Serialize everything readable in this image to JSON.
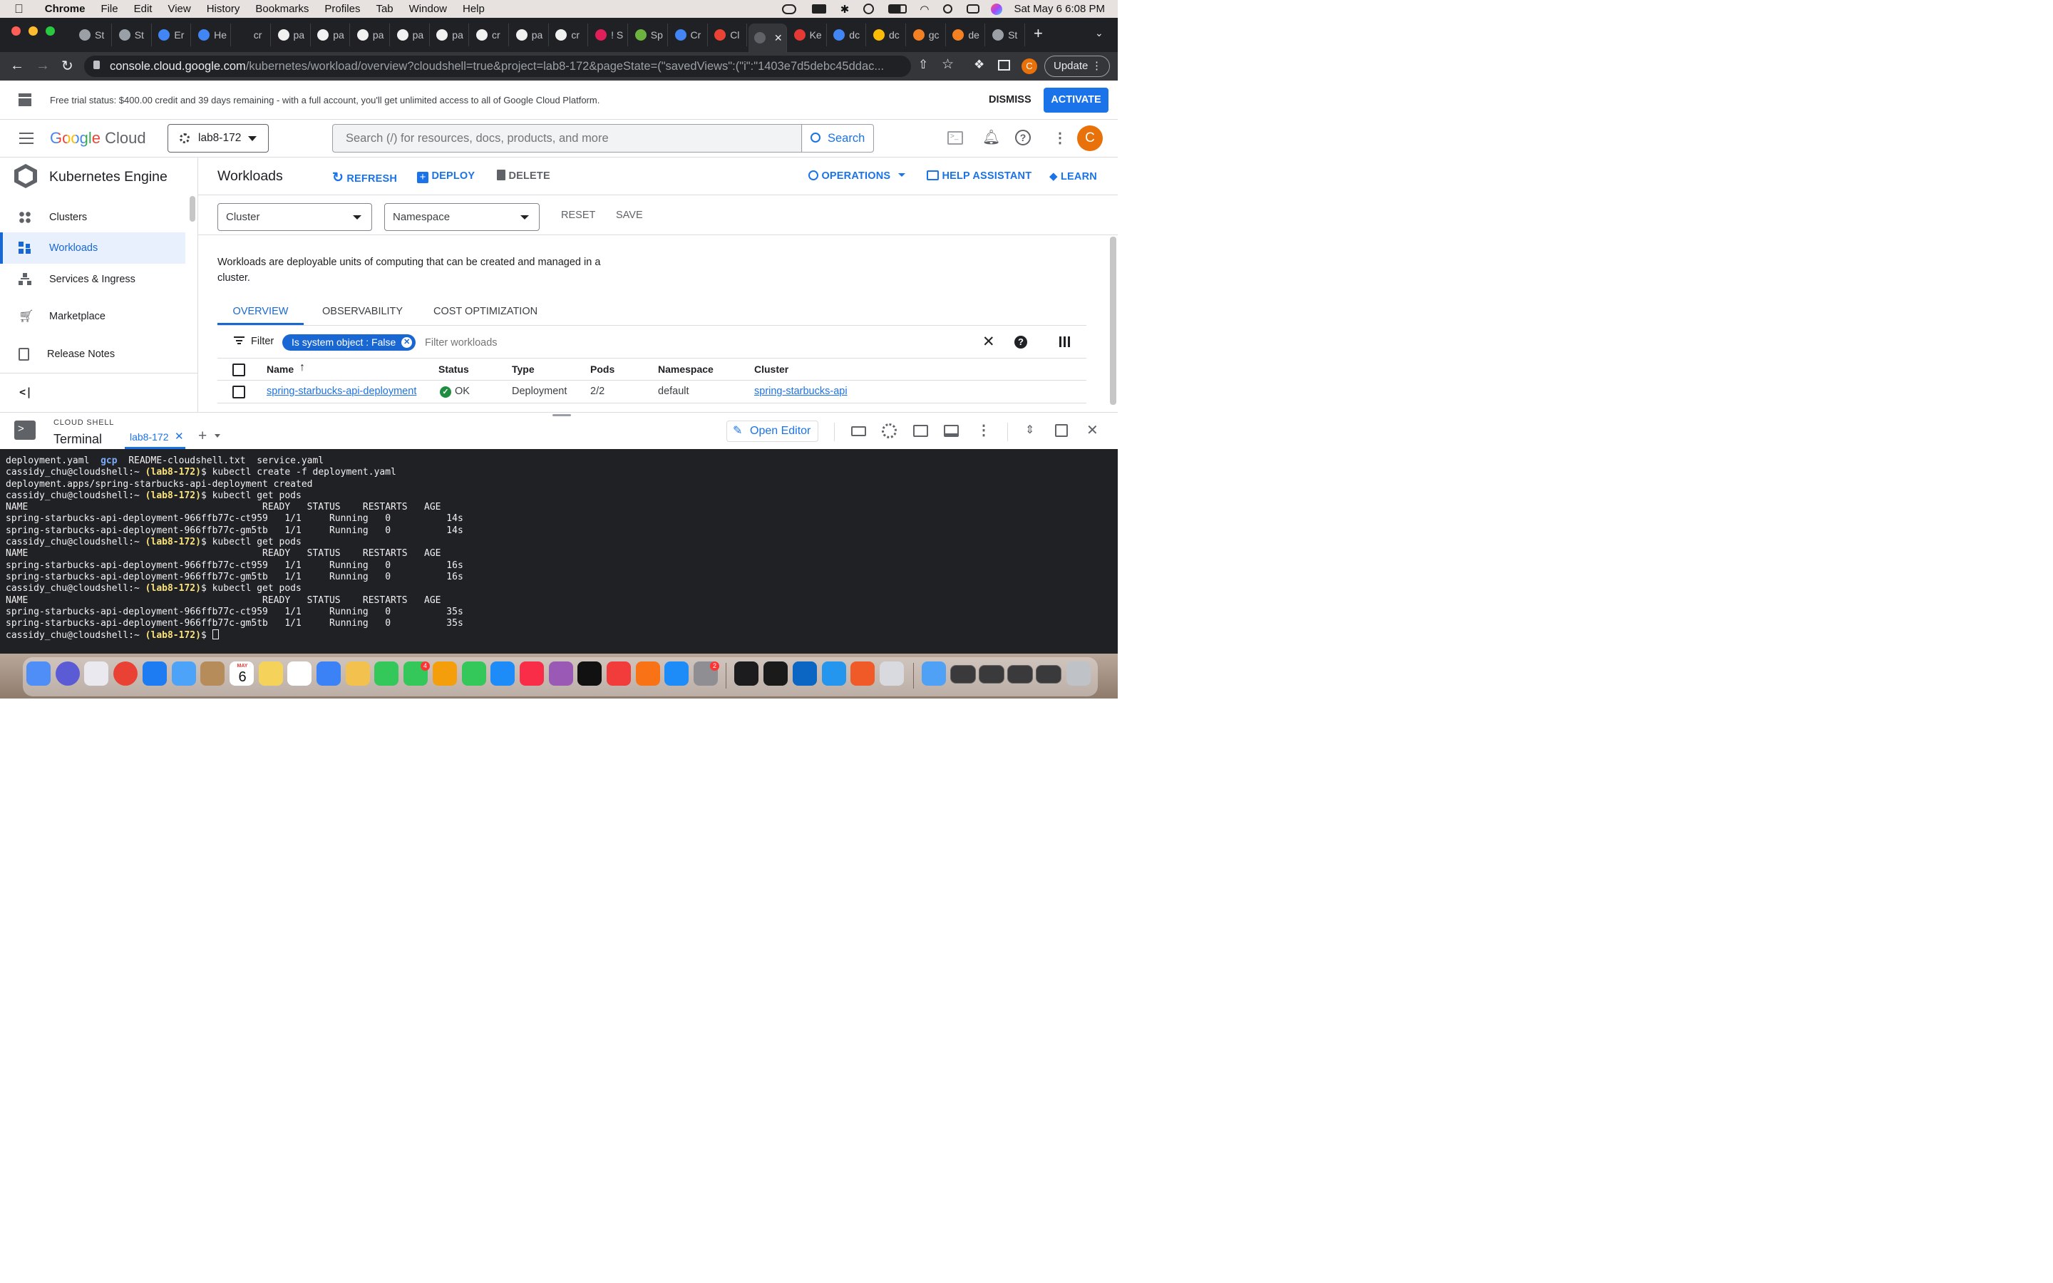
{
  "menubar": {
    "app": "Chrome",
    "items": [
      "File",
      "Edit",
      "View",
      "History",
      "Bookmarks",
      "Profiles",
      "Tab",
      "Window",
      "Help"
    ],
    "clock": "Sat May 6  6:08 PM"
  },
  "tabs": [
    "St",
    "St",
    "Er",
    "He",
    "cr",
    "pa",
    "pa",
    "pa",
    "pa",
    "pa",
    "cr",
    "pa",
    "cr",
    "! S",
    "Sp",
    "Cr",
    "Cl",
    "",
    "Ke",
    "dc",
    "dc",
    "gc",
    "de",
    "St"
  ],
  "browser": {
    "url_host": "console.cloud.google.com",
    "url_path": "/kubernetes/workload/overview?cloudshell=true&project=lab8-172&pageState=(\"savedViews\":(\"i\":\"1403e7d5debc45ddac...",
    "update_label": "Update",
    "profile_initial": "C"
  },
  "trial": {
    "text": "Free trial status: $400.00 credit and 39 days remaining - with a full account, you'll get unlimited access to all of Google Cloud Platform.",
    "dismiss": "DISMISS",
    "activate": "ACTIVATE"
  },
  "header": {
    "logo_google": "Google",
    "logo_cloud": "Cloud",
    "project": "lab8-172",
    "search_placeholder": "Search (/) for resources, docs, products, and more",
    "search_button": "Search",
    "avatar": "C"
  },
  "sidebar": {
    "title": "Kubernetes Engine",
    "items": [
      "Clusters",
      "Workloads",
      "Services & Ingress",
      "Marketplace",
      "Release Notes"
    ],
    "collapse": "<|"
  },
  "page": {
    "title": "Workloads",
    "refresh": "REFRESH",
    "deploy": "DEPLOY",
    "delete": "DELETE",
    "operations": "OPERATIONS",
    "help_assistant": "HELP ASSISTANT",
    "learn": "LEARN",
    "cluster_select": "Cluster",
    "namespace_select": "Namespace",
    "reset": "RESET",
    "save": "SAVE",
    "description": "Workloads are deployable units of computing that can be created and managed in a cluster.",
    "tabs": [
      "OVERVIEW",
      "OBSERVABILITY",
      "COST OPTIMIZATION"
    ],
    "filter_label": "Filter",
    "filter_chip": "Is system object : False",
    "filter_placeholder": "Filter workloads"
  },
  "table": {
    "columns": [
      "Name",
      "Status",
      "Type",
      "Pods",
      "Namespace",
      "Cluster"
    ],
    "rows": [
      {
        "name": "spring-starbucks-api-deployment",
        "status": "OK",
        "type": "Deployment",
        "pods": "2/2",
        "namespace": "default",
        "cluster": "spring-starbucks-api"
      }
    ]
  },
  "shell": {
    "label": "CLOUD SHELL",
    "title": "Terminal",
    "session_tab": "lab8-172",
    "open_editor": "Open Editor",
    "lines": [
      [
        {
          "t": "deployment.yaml  "
        },
        {
          "t": "gcp",
          "c": "b"
        },
        {
          "t": "  README-cloudshell.txt  service.yaml"
        }
      ],
      [
        {
          "t": "cassidy_chu@cloudshell:~ "
        },
        {
          "t": "(lab8-172)",
          "c": "y"
        },
        {
          "t": "$ kubectl create -f deployment.yaml"
        }
      ],
      [
        {
          "t": "deployment.apps/spring-starbucks-api-deployment created"
        }
      ],
      [
        {
          "t": "cassidy_chu@cloudshell:~ "
        },
        {
          "t": "(lab8-172)",
          "c": "y"
        },
        {
          "t": "$ kubectl get pods"
        }
      ],
      [
        {
          "t": "NAME                                          READY   STATUS    RESTARTS   AGE"
        }
      ],
      [
        {
          "t": "spring-starbucks-api-deployment-966ffb77c-ct959   1/1     Running   0          14s"
        }
      ],
      [
        {
          "t": "spring-starbucks-api-deployment-966ffb77c-gm5tb   1/1     Running   0          14s"
        }
      ],
      [
        {
          "t": "cassidy_chu@cloudshell:~ "
        },
        {
          "t": "(lab8-172)",
          "c": "y"
        },
        {
          "t": "$ kubectl get pods"
        }
      ],
      [
        {
          "t": "NAME                                          READY   STATUS    RESTARTS   AGE"
        }
      ],
      [
        {
          "t": "spring-starbucks-api-deployment-966ffb77c-ct959   1/1     Running   0          16s"
        }
      ],
      [
        {
          "t": "spring-starbucks-api-deployment-966ffb77c-gm5tb   1/1     Running   0          16s"
        }
      ],
      [
        {
          "t": "cassidy_chu@cloudshell:~ "
        },
        {
          "t": "(lab8-172)",
          "c": "y"
        },
        {
          "t": "$ kubectl get pods"
        }
      ],
      [
        {
          "t": "NAME                                          READY   STATUS    RESTARTS   AGE"
        }
      ],
      [
        {
          "t": "spring-starbucks-api-deployment-966ffb77c-ct959   1/1     Running   0          35s"
        }
      ],
      [
        {
          "t": "spring-starbucks-api-deployment-966ffb77c-gm5tb   1/1     Running   0          35s"
        }
      ],
      [
        {
          "t": "cassidy_chu@cloudshell:~ "
        },
        {
          "t": "(lab8-172)",
          "c": "y"
        },
        {
          "t": "$ "
        }
      ]
    ]
  },
  "dock": {
    "calendar_month": "MAY",
    "calendar_day": "6",
    "facetime_badge": "4",
    "settings_badge": "2",
    "icon_colors": [
      "#4f8ef7",
      "#5b5bd6",
      "#e9e9ef",
      "#e94235",
      "#1e7cf2",
      "#4da3f7",
      "#b58c5a",
      "#ffffff",
      "#f5d35b",
      "#ffffff",
      "#3b82f6",
      "#f2c14e",
      "#34c759",
      "#34c759",
      "#f59e0b",
      "#34c759",
      "#1d8cf8",
      "#fa2d48",
      "#9b59b6",
      "#111111",
      "#f23b3b",
      "#f97316",
      "#1d8cf8",
      "#8e8e93",
      "#1c1c1e",
      "#1a1a1a",
      "#0a66c2",
      "#2496ed",
      "#f05a28",
      "#d9d9e0",
      "#4ea1f5",
      "#3a3a3c",
      "#3a3a3c",
      "#3a3a3c",
      "#3a3a3c",
      "#bfc3c7"
    ]
  },
  "colors": {
    "accent": "#1a73e8",
    "ok": "#1e8e3e",
    "chip": "#1967d2",
    "terminal_bg": "#202124"
  }
}
